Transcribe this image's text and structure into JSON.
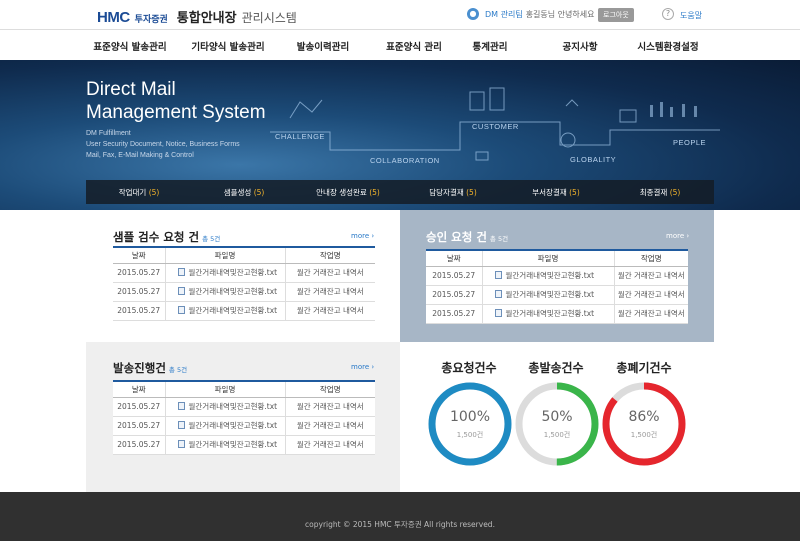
{
  "header": {
    "logo_brand": "HMC",
    "logo_company": "투자증권",
    "logo_main": "통합안내장",
    "logo_sub": "관리시스템",
    "user_name": "DM 관리팀",
    "user_greeting": "홍길동님 안녕하세요",
    "logout_label": "로그아웃",
    "help_label": "도움말"
  },
  "nav": [
    "표준양식 발송관리",
    "기타양식 발송관리",
    "발송이력관리",
    "표준양식 관리",
    "통계관리",
    "공지사항",
    "시스템환경설정"
  ],
  "hero": {
    "title_line1": "Direct Mail",
    "title_line2": "Management System",
    "desc_line1": "DM Fulfillment",
    "desc_line2": "User Security Document, Notice, Business Forms",
    "desc_line3": "Mail, Fax, E-Mail Making & Control",
    "words": [
      "CHALLENGE",
      "COLLABORATION",
      "CUSTOMER",
      "GLOBALITY",
      "PEOPLE"
    ]
  },
  "steps": [
    {
      "label": "작업대기",
      "count": "(5)"
    },
    {
      "label": "샘플생성",
      "count": "(5)"
    },
    {
      "label": "안내장 생성완료",
      "count": "(5)"
    },
    {
      "label": "담당자결재",
      "count": "(5)"
    },
    {
      "label": "부서장결재",
      "count": "(5)"
    },
    {
      "label": "최종결재",
      "count": "(5)"
    }
  ],
  "sample_panel": {
    "title": "샘플 검수 요청 건",
    "count": "총 5건",
    "more": "more ›",
    "columns": [
      "날짜",
      "파일명",
      "작업명"
    ],
    "rows": [
      [
        "2015.05.27",
        "월간거래내역및잔고현황.txt",
        "월간 거래잔고 내역서"
      ],
      [
        "2015.05.27",
        "월간거래내역및잔고현황.txt",
        "월간 거래잔고 내역서"
      ],
      [
        "2015.05.27",
        "월간거래내역및잔고현황.txt",
        "월간 거래잔고 내역서"
      ]
    ]
  },
  "approve_panel": {
    "title": "승인 요청 건",
    "count": "총 5건",
    "more": "more ›",
    "columns": [
      "날짜",
      "파일명",
      "작업명"
    ],
    "rows": [
      [
        "2015.05.27",
        "월간거래내역및잔고현황.txt",
        "월간 거래잔고 내역서"
      ],
      [
        "2015.05.27",
        "월간거래내역및잔고현황.txt",
        "월간 거래잔고 내역서"
      ],
      [
        "2015.05.27",
        "월간거래내역및잔고현황.txt",
        "월간 거래잔고 내역서"
      ]
    ]
  },
  "send_panel": {
    "title": "발송진행건",
    "count": "총 5건",
    "more": "more ›",
    "columns": [
      "날짜",
      "파일명",
      "작업명"
    ],
    "rows": [
      [
        "2015.05.27",
        "월간거래내역및잔고현황.txt",
        "월간 거래잔고 내역서"
      ],
      [
        "2015.05.27",
        "월간거래내역및잔고현황.txt",
        "월간 거래잔고 내역서"
      ],
      [
        "2015.05.27",
        "월간거래내역및잔고현황.txt",
        "월간 거래잔고 내역서"
      ]
    ]
  },
  "stats": [
    {
      "title": "총요청건수",
      "percent_label": "100%",
      "fraction": 1.0,
      "count": "1,500건",
      "color": "#1e8bc3"
    },
    {
      "title": "총발송건수",
      "percent_label": "50%",
      "fraction": 0.5,
      "count": "1,500건",
      "color": "#3ab54a"
    },
    {
      "title": "총폐기건수",
      "percent_label": "86%",
      "fraction": 0.86,
      "count": "1,500건",
      "color": "#e5262d"
    }
  ],
  "footer": {
    "copyright": "copyright © 2015 HMC 투자증권 All rights reserved."
  }
}
